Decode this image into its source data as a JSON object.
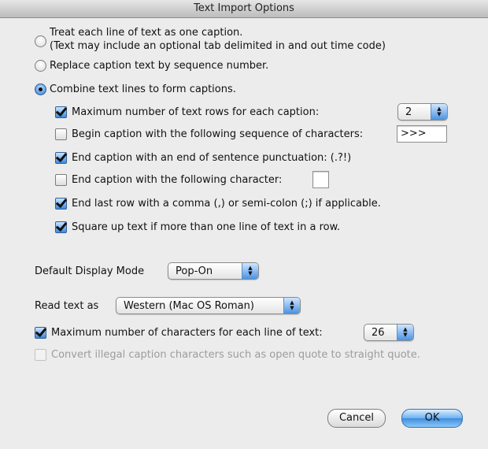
{
  "window": {
    "title": "Text Import Options"
  },
  "options": {
    "radio_treat_line": "Treat each line of text as one caption.",
    "radio_treat_line_note": "(Text may include an optional tab delimited in and out time code)",
    "radio_replace": "Replace caption text by sequence number.",
    "radio_combine": "Combine text lines to form captions.",
    "selected_radio": "combine"
  },
  "combine": {
    "max_rows_label": "Maximum number of text rows for each caption:",
    "max_rows_value": "2",
    "max_rows_checked": true,
    "begin_seq_label": "Begin caption with the following sequence of characters:",
    "begin_seq_value": ">>>",
    "begin_seq_checked": false,
    "end_punct_label": "End caption with an end of sentence punctuation:  (.?!)",
    "end_punct_checked": true,
    "end_char_label": "End caption with the following character:",
    "end_char_value": "",
    "end_char_checked": false,
    "end_comma_label": "End last row with a comma (,) or semi-colon (;) if applicable.",
    "end_comma_checked": true,
    "square_label": "Square up text if more than one line of text in a row.",
    "square_checked": true
  },
  "display_mode": {
    "label": "Default Display Mode",
    "value": "Pop-On"
  },
  "read_as": {
    "label": "Read text as",
    "value": "Western (Mac OS Roman)"
  },
  "max_chars": {
    "label": "Maximum number of characters for each line of text:",
    "value": "26",
    "checked": true
  },
  "convert_quotes": {
    "label": "Convert illegal caption characters such as open quote to straight quote.",
    "checked": false,
    "disabled": true
  },
  "buttons": {
    "cancel": "Cancel",
    "ok": "OK"
  },
  "colors": {
    "accent": "#3e8ee0",
    "background": "#ececec"
  }
}
